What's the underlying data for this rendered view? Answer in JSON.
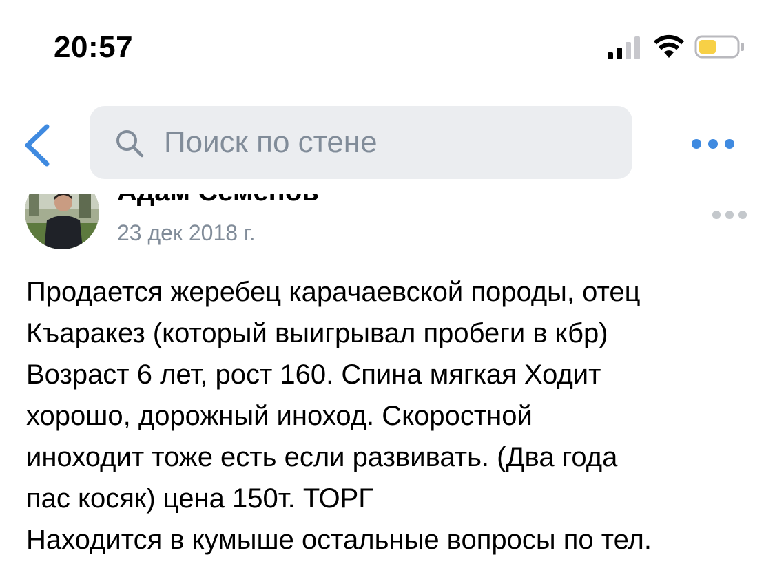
{
  "status_bar": {
    "time": "20:57"
  },
  "header": {
    "search_placeholder": "Поиск по стене"
  },
  "post": {
    "author": "Адам Семенов",
    "date": "23 дек 2018 г.",
    "text_lines": [
      "Продается жеребец карачаевской породы, отец",
      "Къаракез (который выигрывал пробеги в кбр)",
      "Возраст 6 лет, рост 160. Спина мягкая Ходит",
      "хорошо, дорожный иноход. Скоростной",
      "иноходит тоже есть если развивать. (Два года",
      "пас косяк) цена 150т. ТОРГ",
      "Находится в кумыше остальные вопросы по тел."
    ]
  },
  "colors": {
    "accent": "#3f8ae0",
    "search_bg": "#ebedf0",
    "secondary_text": "#818c99",
    "battery_fill": "#f7d046"
  }
}
